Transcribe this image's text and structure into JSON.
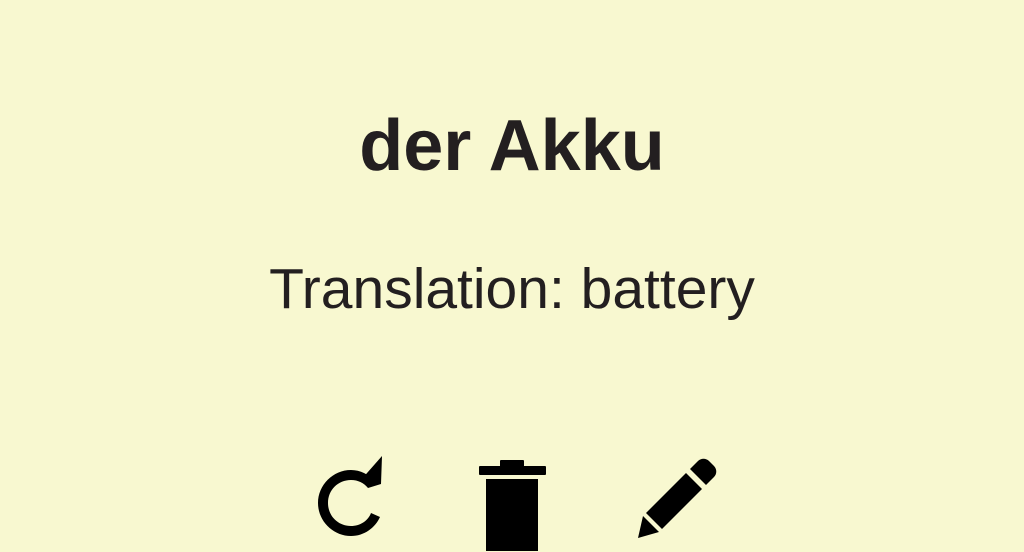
{
  "card": {
    "word": "der Akku",
    "translation": "Translation: battery"
  },
  "actions": [
    {
      "name": "retry-button",
      "icon": "refresh-icon"
    },
    {
      "name": "delete-button",
      "icon": "trash-icon"
    },
    {
      "name": "edit-button",
      "icon": "pencil-icon"
    }
  ],
  "colors": {
    "background": "#f8f8d0",
    "text": "#231f20",
    "icons": "#000000"
  }
}
